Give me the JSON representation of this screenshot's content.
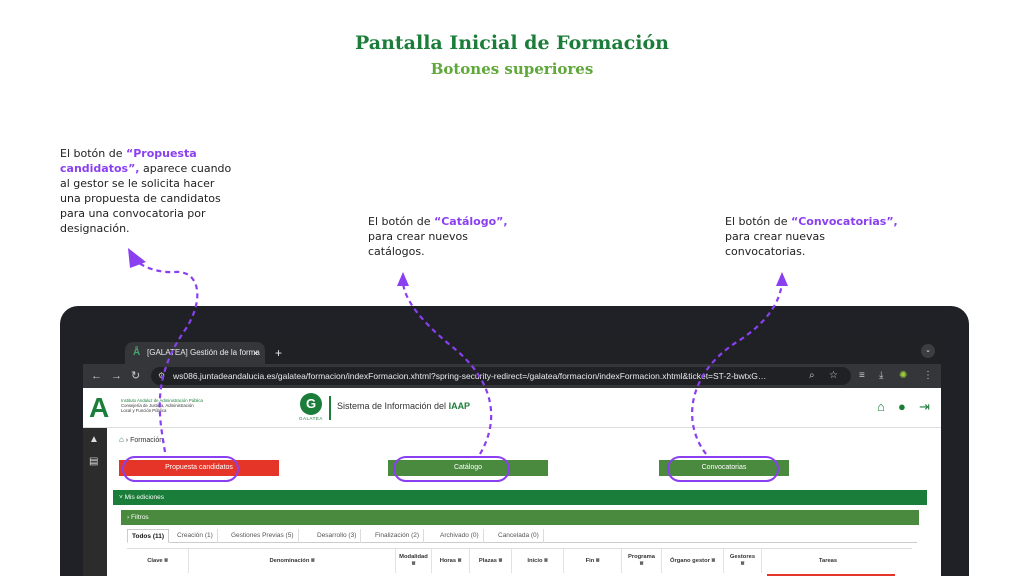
{
  "slide": {
    "title": "Pantalla Inicial de Formación",
    "subtitle": "Botones superiores"
  },
  "notes": {
    "propuesta": {
      "pre": "El botón de ",
      "highlight": "“Propuesta candidatos”,",
      "post": " aparece cuando al gestor se le solicita hacer una propuesta de candidatos para una convocatoria por designación."
    },
    "catalogo": {
      "pre": "El botón de ",
      "highlight": "“Catálogo”,",
      "post": " para crear nuevos catálogos."
    },
    "convocatorias": {
      "pre": "El botón de ",
      "highlight": "“Convocatorias”,",
      "post": " para crear nuevas convocatorias."
    }
  },
  "colors": {
    "accent": "#8a3ff0",
    "brand_green": "#1b7d3a",
    "button_red": "#e53528",
    "button_green": "#4a8a3e"
  },
  "browser": {
    "tab_title": "[GALATEA] Gestión de la forma",
    "tab_close": "×",
    "new_tab": "+",
    "url": "ws086.juntadeandalucia.es/galatea/formacion/indexFormacion.xhtml?spring-security-redirect=/galatea/formacion/indexFormacion.xhtml&ticket=ST-2-bwtxG…"
  },
  "app": {
    "org_name": "Instituto Andaluz de Administración Pública",
    "org_sub1": "Consejería de Justicia, Administración",
    "org_sub2": "Local y Función Pública",
    "galatea_letter": "G",
    "galatea_label": "GALATEA",
    "system_title": "Sistema de Información del ",
    "system_title_bold": "IAAP",
    "breadcrumb": "Formación",
    "buttons": {
      "propuesta": "Propuesta candidatos",
      "catalogo": "Catálogo",
      "convocatorias": "Convocatorias"
    },
    "section_title": "Mis ediciones",
    "filters_title": "Filtros",
    "tabs": [
      "Todos (11)",
      "Creación (1)",
      "Gestiones Previas (5)",
      "Desarrollo (3)",
      "Finalización (2)",
      "Archivado (0)",
      "Cancelada (0)"
    ],
    "columns": [
      "Clave",
      "Denominación",
      "Modalidad",
      "Horas",
      "Plazas",
      "Inicio",
      "Fin",
      "Programa",
      "Órgano gestor",
      "Gestores",
      "Tareas"
    ]
  },
  "icons": [
    "home-icon",
    "user-icon",
    "logout-icon",
    "graduation-icon",
    "book-icon",
    "reload-icon",
    "back-icon",
    "forward-icon"
  ]
}
